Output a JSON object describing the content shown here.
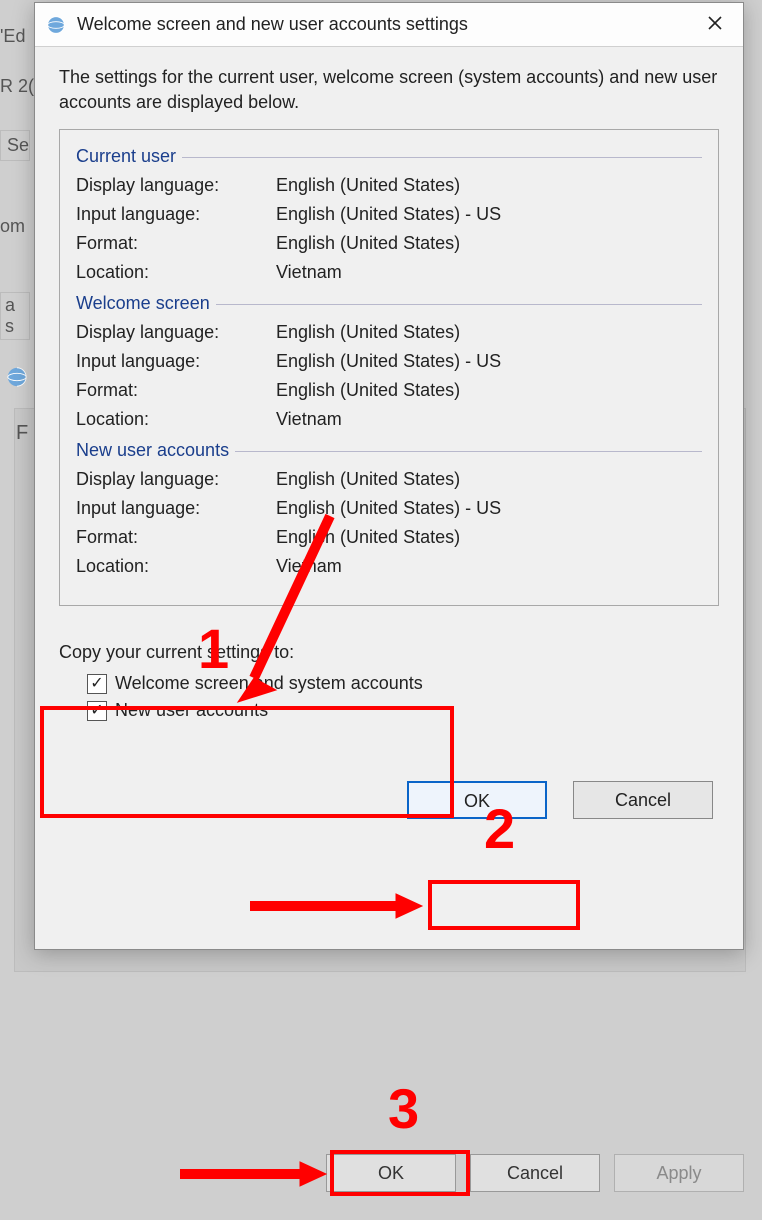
{
  "dialog": {
    "title": "Welcome screen and new user accounts settings",
    "intro": "The settings for the current user, welcome screen (system accounts) and new user accounts are displayed below.",
    "fields": {
      "display_language": "Display language:",
      "input_language": "Input language:",
      "format": "Format:",
      "location": "Location:"
    },
    "groups": {
      "current_user": {
        "title": "Current user",
        "display_language": "English (United States)",
        "input_language": "English (United States) - US",
        "format": "English (United States)",
        "location": "Vietnam"
      },
      "welcome_screen": {
        "title": "Welcome screen",
        "display_language": "English (United States)",
        "input_language": "English (United States) - US",
        "format": "English (United States)",
        "location": "Vietnam"
      },
      "new_user_accounts": {
        "title": "New user accounts",
        "display_language": "English (United States)",
        "input_language": "English (United States) - US",
        "format": "English (United States)",
        "location": "Vietnam"
      }
    },
    "copy": {
      "title": "Copy your current settings to:",
      "welcome_checkbox": "Welcome screen and system accounts",
      "newuser_checkbox": "New user accounts",
      "welcome_checked": "✓",
      "newuser_checked": "✓"
    },
    "buttons": {
      "ok": "OK",
      "cancel": "Cancel"
    }
  },
  "parent_window": {
    "frag_ed": "'Ed",
    "frag_r2": "R 2(",
    "frag_se": "Se",
    "frag_om": "om",
    "frag_as": "a s",
    "frag_f": "F",
    "buttons": {
      "ok": "OK",
      "cancel": "Cancel",
      "apply": "Apply"
    }
  },
  "annotations": {
    "n1": "1",
    "n2": "2",
    "n3": "3"
  }
}
